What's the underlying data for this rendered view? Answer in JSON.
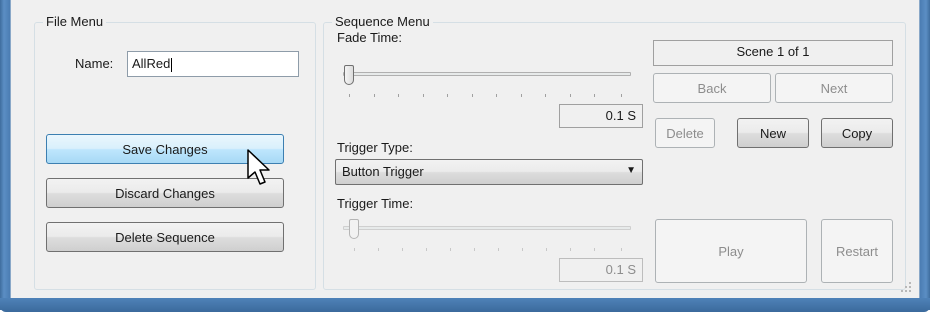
{
  "file_menu": {
    "title": "File Menu",
    "name_label": "Name:",
    "name_value": "AllRed",
    "save_label": "Save Changes",
    "discard_label": "Discard Changes",
    "delete_label": "Delete Sequence"
  },
  "sequence_menu": {
    "title": "Sequence Menu",
    "fade_time_label": "Fade Time:",
    "fade_time_value": "0.1 S",
    "trigger_type_label": "Trigger Type:",
    "trigger_type_value": "Button Trigger",
    "trigger_time_label": "Trigger Time:",
    "trigger_time_value": "0.1 S",
    "scene_indicator": "Scene 1 of 1",
    "back_label": "Back",
    "next_label": "Next",
    "delete_label": "Delete",
    "new_label": "New",
    "copy_label": "Copy",
    "play_label": "Play",
    "restart_label": "Restart"
  }
}
